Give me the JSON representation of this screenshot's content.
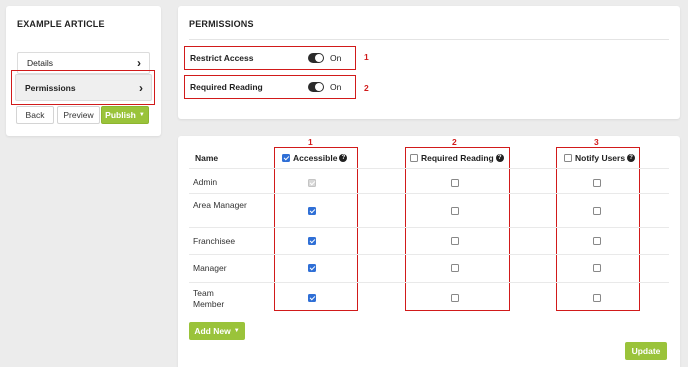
{
  "article": {
    "title": "EXAMPLE ARTICLE",
    "nav": [
      {
        "label": "Details"
      },
      {
        "label": "Permissions"
      }
    ],
    "buttons": {
      "back": "Back",
      "preview": "Preview",
      "publish": "Publish"
    }
  },
  "permissions": {
    "title": "PERMISSIONS",
    "settings": [
      {
        "label": "Restrict Access",
        "state": "On",
        "enabled": true,
        "marker": "1"
      },
      {
        "label": "Required Reading",
        "state": "On",
        "enabled": true,
        "marker": "2"
      }
    ]
  },
  "table": {
    "columns": [
      {
        "label": "Name"
      },
      {
        "label": "Accessible",
        "marker": "1",
        "header_checked": true
      },
      {
        "label": "Required Reading",
        "marker": "2",
        "header_checked": false
      },
      {
        "label": "Notify Users",
        "marker": "3",
        "header_checked": false
      }
    ],
    "rows": [
      {
        "name": "Admin",
        "accessible": true,
        "accessible_disabled": true,
        "required_reading": false,
        "notify_users": false
      },
      {
        "name": "Area Manager",
        "accessible": true,
        "accessible_disabled": false,
        "required_reading": false,
        "notify_users": false
      },
      {
        "name": "Franchisee",
        "accessible": true,
        "accessible_disabled": false,
        "required_reading": false,
        "notify_users": false
      },
      {
        "name": "Manager",
        "accessible": true,
        "accessible_disabled": false,
        "required_reading": false,
        "notify_users": false
      },
      {
        "name": "Team Member",
        "accessible": true,
        "accessible_disabled": false,
        "required_reading": false,
        "notify_users": false
      }
    ],
    "add_new_label": "Add New",
    "update_label": "Update"
  },
  "colors": {
    "accent_green": "#9ac33a",
    "highlight_red": "#d11a1a",
    "checkbox_blue": "#2f6fd6"
  }
}
